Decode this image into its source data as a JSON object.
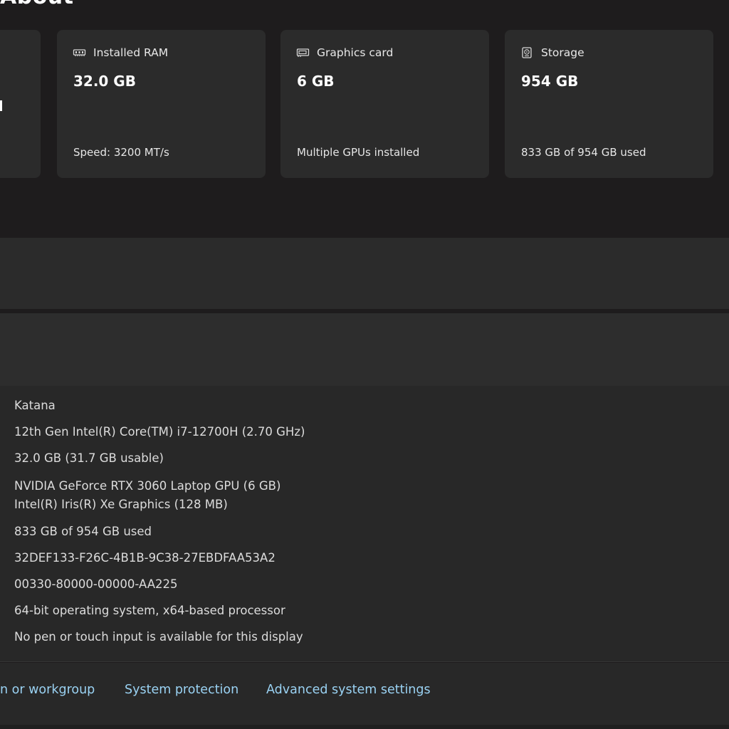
{
  "header": {
    "title": "About"
  },
  "cards": {
    "ram": {
      "icon": "ram-icon",
      "label": "Installed RAM",
      "value": "32.0 GB",
      "detail": "Speed: 3200 MT/s"
    },
    "graphics": {
      "icon": "graphics-card-icon",
      "label": "Graphics card",
      "value": "6 GB",
      "detail": "Multiple GPUs installed"
    },
    "storage": {
      "icon": "storage-icon",
      "label": "Storage",
      "value": "954 GB",
      "detail": "833 GB of 954 GB used"
    }
  },
  "specs": {
    "device_name": "Katana",
    "processor": "12th Gen Intel(R) Core(TM) i7-12700H (2.70 GHz)",
    "installed_ram": "32.0 GB (31.7 GB usable)",
    "graphics_line1": "NVIDIA GeForce RTX 3060 Laptop GPU (6 GB)",
    "graphics_line2": "Intel(R) Iris(R) Xe Graphics (128 MB)",
    "storage": "833 GB of 954 GB used",
    "device_id": "32DEF133-F26C-4B1B-9C38-27EBDFAA53A2",
    "product_id": "00330-80000-00000-AA225",
    "system_type": "64-bit operating system, x64-based processor",
    "pen_touch": "No pen or touch input is available for this display"
  },
  "links": {
    "domain": "n or workgroup",
    "system_protection": "System protection",
    "advanced": "Advanced system settings"
  },
  "colors": {
    "background": "#1e1c1d",
    "card": "#2b2b2b",
    "link": "#9ad2f3"
  }
}
